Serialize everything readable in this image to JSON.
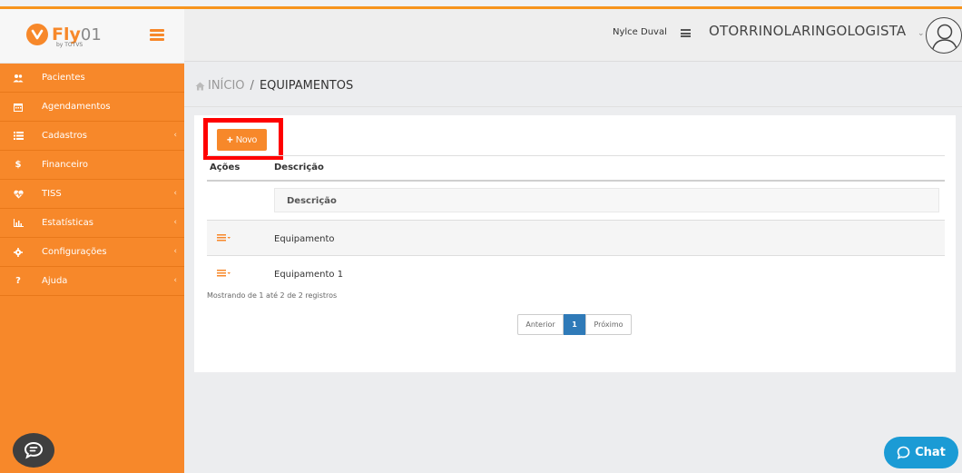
{
  "app": {
    "logo_main": "Fly",
    "logo_suffix": "01",
    "logo_by": "by TOTVS"
  },
  "sidebar": {
    "items": [
      {
        "label": "Pacientes",
        "icon": "users-icon",
        "has_submenu": false
      },
      {
        "label": "Agendamentos",
        "icon": "calendar-icon",
        "has_submenu": false
      },
      {
        "label": "Cadastros",
        "icon": "list-icon",
        "has_submenu": true
      },
      {
        "label": "Financeiro",
        "icon": "dollar-icon",
        "has_submenu": false
      },
      {
        "label": "TISS",
        "icon": "heartbeat-icon",
        "has_submenu": true
      },
      {
        "label": "Estatísticas",
        "icon": "bar-chart-icon",
        "has_submenu": true
      },
      {
        "label": "Configurações",
        "icon": "gear-icon",
        "has_submenu": true
      },
      {
        "label": "Ajuda",
        "icon": "question-icon",
        "has_submenu": true
      }
    ]
  },
  "header": {
    "user_name": "Nylce Duval",
    "specialty": "OTORRINOLARINGOLOGISTA"
  },
  "breadcrumb": {
    "home": "INÍCIO",
    "separator": "/",
    "current": "EQUIPAMENTOS"
  },
  "toolbar": {
    "new_label": "Novo"
  },
  "table": {
    "columns": [
      "Ações",
      "Descrição"
    ],
    "filter_label": "Descrição",
    "rows": [
      {
        "descricao": "Equipamento"
      },
      {
        "descricao": "Equipamento 1"
      }
    ],
    "records_info": "Mostrando de 1 até 2 de 2 registros"
  },
  "pagination": {
    "prev": "Anterior",
    "current": "1",
    "next": "Próximo"
  },
  "chat": {
    "label": "Chat"
  },
  "colors": {
    "accent": "#f7882a",
    "highlight": "#ff0000",
    "pagination_active": "#2f7ab8",
    "chat": "#1b9bd5"
  }
}
